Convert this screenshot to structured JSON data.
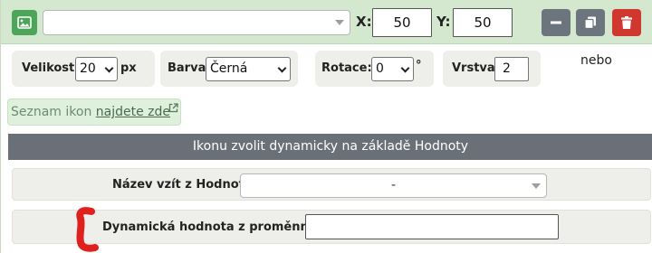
{
  "header": {
    "icon_select_value": "",
    "x_label": "X:",
    "x_value": "50",
    "y_label": "Y:",
    "y_value": "50"
  },
  "settings": {
    "size_label": "Velikost:",
    "size_value": "20",
    "size_unit": "px",
    "color_label": "Barva:",
    "color_value": "Černá",
    "rotation_label": "Rotace:",
    "rotation_value": "0",
    "rotation_unit": "°",
    "layer_label": "Vrstva:",
    "layer_value": "2",
    "or_text": "nebo"
  },
  "icon_list": {
    "prefix": "Seznam ikon ",
    "link_text": "najdete zde"
  },
  "dynamic_section": {
    "title": "Ikonu zvolit dynamicky na základě Hodnoty",
    "name_from_value_label": "Název vzít z Hodnoty:",
    "name_from_value_selected": "-",
    "dynamic_value_label": "Dynamická hodnota z proměnných:",
    "dynamic_value_input": ""
  },
  "colors": {
    "header_bg": "#d3e8cf",
    "primary_green": "#4da55a",
    "secondary_gray": "#6c757d",
    "danger_red": "#d0372f",
    "section_bar": "#6a7078",
    "annotation_red": "#e0201c"
  },
  "icons": [
    "image-icon",
    "minus-icon",
    "copy-icon",
    "trash-icon",
    "external-link-icon",
    "chevron-down-icon"
  ]
}
